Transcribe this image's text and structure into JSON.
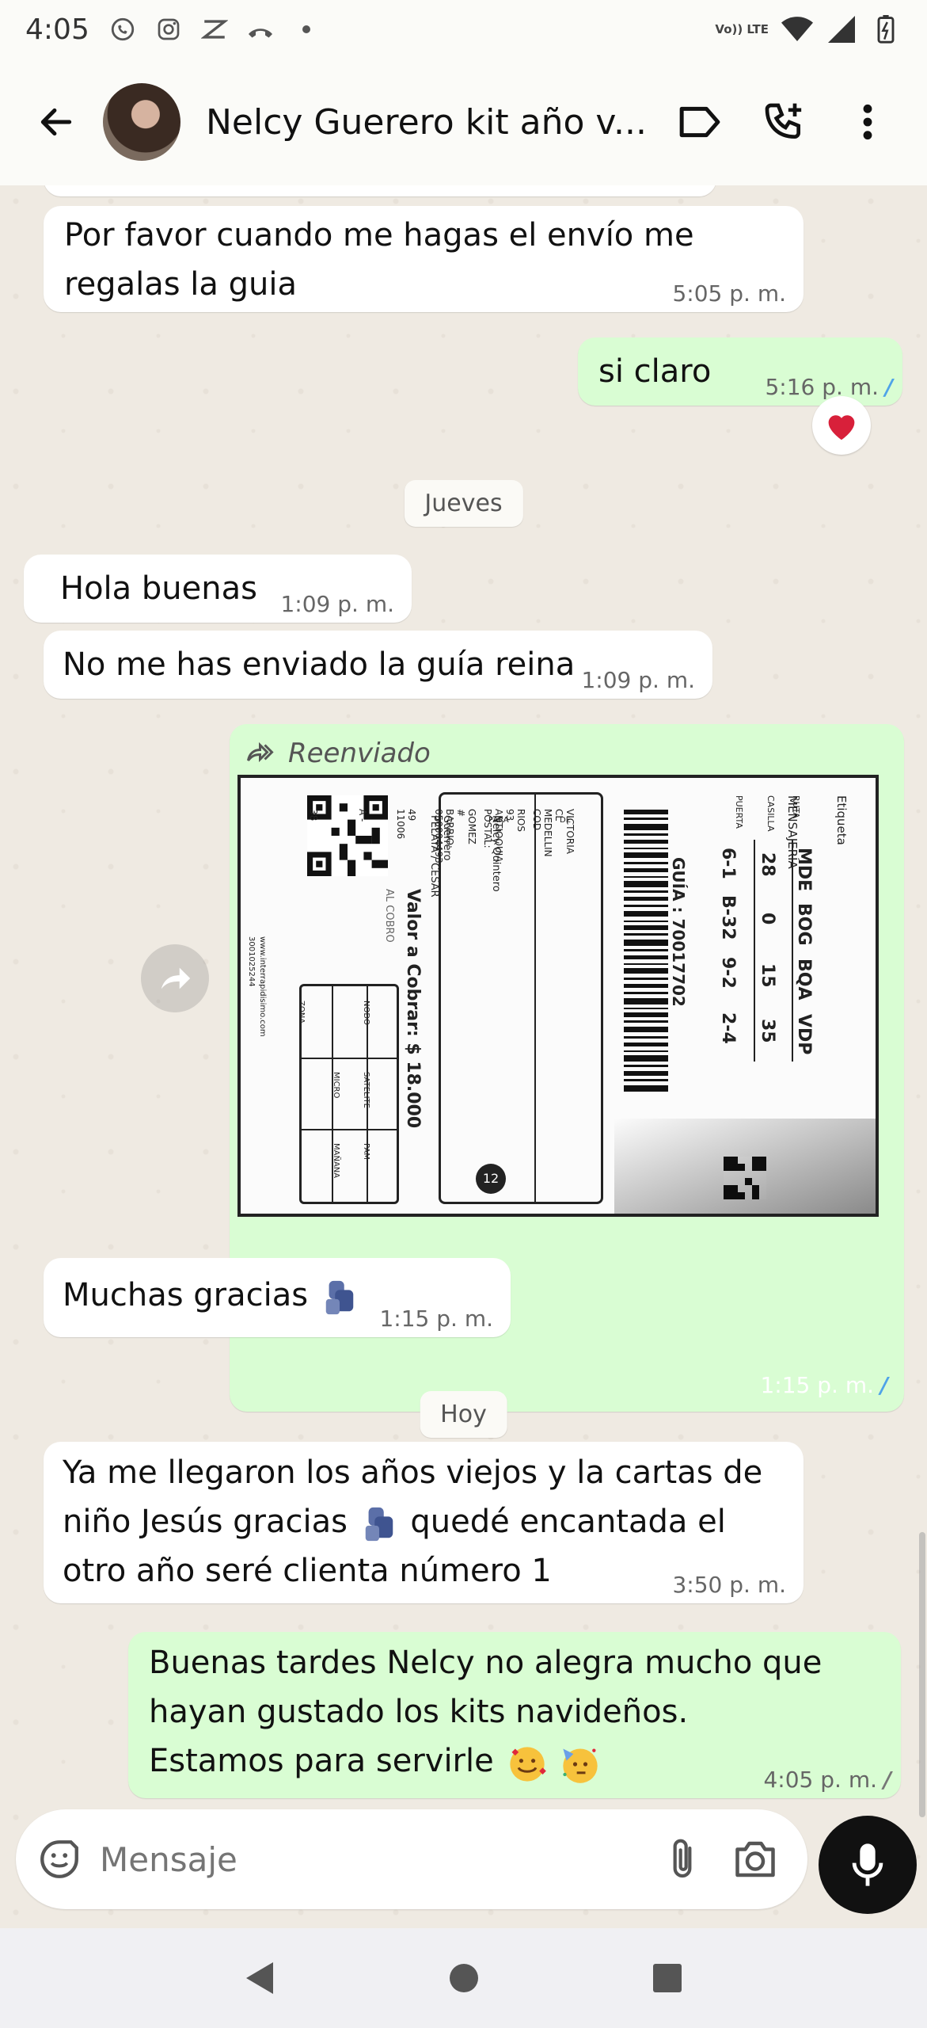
{
  "status_bar": {
    "time": "4:05",
    "volte": "Vo)) LTE"
  },
  "header": {
    "contact_name": "Nelcy Guerero kit año v..."
  },
  "messages": [
    {
      "id": "m1",
      "text_line1": "Por favor cuando me hagas el envío me",
      "text_line2": "regalas la guia",
      "time": "5:05 p. m."
    },
    {
      "id": "m2",
      "text": "si claro",
      "time": "5:16 p. m.",
      "reaction": "heart"
    },
    {
      "id": "m3",
      "text": "Hola buenas",
      "time": "1:09 p. m."
    },
    {
      "id": "m4",
      "text": "No me has enviado la guía reina",
      "time": "1:09 p. m."
    },
    {
      "id": "m5",
      "forward_label": "Reenviado",
      "time": "1:15 p. m."
    },
    {
      "id": "m6",
      "text": "Muchas gracias",
      "time": "1:15 p. m."
    },
    {
      "id": "m7",
      "line1": "Ya me llegaron los años viejos y la cartas de",
      "line2a": "niño Jesús gracias",
      "line2b": "quedé encantada el",
      "line3": "otro año seré clienta número 1",
      "time": "3:50 p. m."
    },
    {
      "id": "m8",
      "line1": "Buenas tardes Nelcy no alegra mucho que",
      "line2": "hayan gustado los kits navideños.",
      "line3": "Estamos para servirle",
      "time": "4:05 p. m."
    }
  ],
  "day_separators": {
    "thursday": "Jueves",
    "today": "Hoy"
  },
  "shipping_label": {
    "etiqueta": "Etiqueta  MENSAJERÍA",
    "routes_header": [
      "MDE",
      "BOG",
      "BQA",
      "VDP"
    ],
    "row_ruta": "RUTA",
    "row_casilla": "CASILLA",
    "row_puerta": "PUERTA",
    "casilla": [
      "28",
      "0",
      "15",
      "35"
    ],
    "puerta": [
      "6-1",
      "B-32",
      "9-2",
      "2-4"
    ],
    "guia": "GUÍA : 70017702",
    "valor": "Valor a Cobrar:  $ 18.000",
    "al_cobro": "AL COBRO",
    "recipient_name": "VICTORIA RIOS GOMEZ",
    "recipient_addr": "CL 93 # 49 A - 38",
    "recipient_city": "MEDELLIN ANTIOQUIA BARRIO: 11006",
    "recipient_postal": "COD POSTAL: 050004493",
    "para_label": "PARA",
    "de_label": "DE",
    "sender_name": "Nelcy Quintero Guerrero",
    "sender_detail": "PELAYA / CESAR",
    "number": "12",
    "grid_labels": [
      "NODO",
      "SATELITE",
      "PAM",
      "ZONA",
      "MICRO",
      "MAÑANA"
    ],
    "website": "www.interrapidisimo.com",
    "phone": "3001025244"
  },
  "input": {
    "placeholder": "Mensaje"
  }
}
